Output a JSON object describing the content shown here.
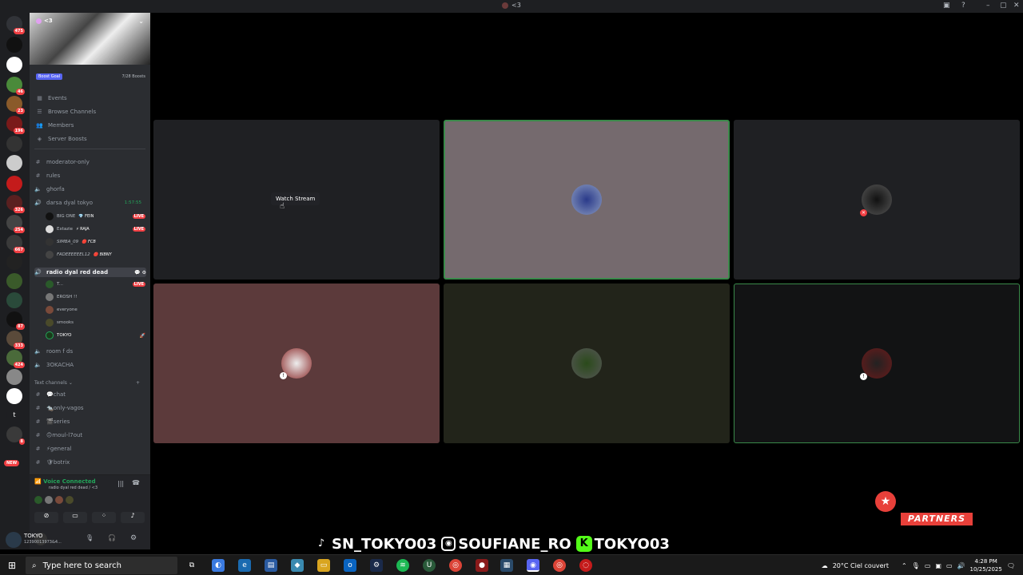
{
  "titlebar": {
    "title": "<3"
  },
  "server": {
    "name": "<3",
    "boost_label": "Boost Goal",
    "boost_count": "7/28 Boosts"
  },
  "rail_badges": [
    "475",
    "46",
    "23",
    "196",
    "326",
    "254",
    "667",
    "87",
    "333",
    "424",
    "8",
    "NEW"
  ],
  "nav": [
    "Events",
    "Browse Channels",
    "Members",
    "Server Boosts"
  ],
  "channels": {
    "moderator_only": "moderator-only",
    "rules": "rules",
    "ghorfa": "ghorfa",
    "voice1": {
      "name": "darsa dyal tokyo",
      "timer": "1:57:55",
      "users": [
        {
          "name": "BIG ONE",
          "tag": "💎 FEIN",
          "live": "LIVE"
        },
        {
          "name": "Extazie",
          "tag": "⚡ RAJA",
          "live": "LIVE"
        },
        {
          "name": "SIMBA_09",
          "tag": "🔴 FCB",
          "live": ""
        },
        {
          "name": "FADEEEEEEL12",
          "tag": "🔴 BIBNY",
          "live": ""
        }
      ]
    },
    "voice2": {
      "name": "radio dyal red dead",
      "users": [
        {
          "name": "T...",
          "live": "LIVE"
        },
        {
          "name": "EROSH !!",
          "live": ""
        },
        {
          "name": "everyone",
          "live": ""
        },
        {
          "name": "smooks",
          "live": ""
        },
        {
          "name": "TOKYO",
          "live": ""
        }
      ]
    },
    "room": "room f ds",
    "sokacha": "3OKACHA",
    "text_category": "Text channels",
    "text": [
      "💬chat",
      "🐀only-vagos",
      "🎬series",
      "🙃moul-l7out",
      "⚡general",
      "🛡botrix"
    ]
  },
  "voice_panel": {
    "status": "Voice Connected",
    "location": "radio dyal red dead / <3"
  },
  "user_panel": {
    "name": "TOKYO",
    "status": "12390013973&4..."
  },
  "stage": {
    "watch_label": "Watch Stream"
  },
  "overlay": {
    "tiktok": "SN_TOKYO03",
    "instagram": "SOUFIANE_RO",
    "kick": "TOKYO03",
    "partners": "PARTNERS"
  },
  "taskbar": {
    "search_placeholder": "Type here to search",
    "weather": "20°C  Ciel couvert",
    "time": "4:28 PM",
    "date": "10/25/2025"
  },
  "colors": {
    "accent": "#23a55a",
    "live": "#f23f43",
    "partners": "#e8403a"
  }
}
